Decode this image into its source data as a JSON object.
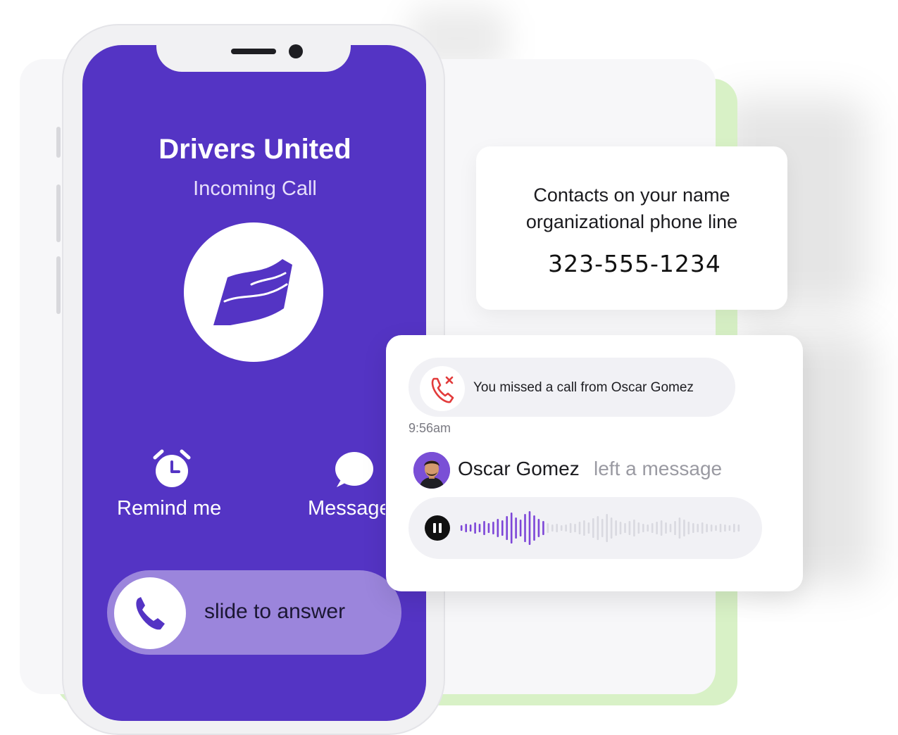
{
  "phone": {
    "caller_name": "Drivers United",
    "call_status": "Incoming Call",
    "actions": {
      "remind_label": "Remind me",
      "message_label": "Message"
    },
    "slide_label": "slide to answer"
  },
  "contact_card": {
    "line1": "Contacts on your name",
    "line2": "organizational phone line",
    "phone_number": "323-555-1234"
  },
  "messages": {
    "missed_call_text": "You missed a call from Oscar Gomez",
    "timestamp": "9:56am",
    "voicemail_sender": "Oscar Gomez",
    "voicemail_text": "left a message",
    "voicemail_progress": 0.3
  },
  "colors": {
    "phone_screen": "#5434c4",
    "slider": "#9b85dc",
    "accent_green": "#d8f1c6",
    "missed_red": "#e23b3b",
    "wave_played": "#7d46d8",
    "wave_unplayed": "#d9d9e0"
  },
  "icons": {
    "logo": "flag-icon",
    "remind": "alarm-clock-icon",
    "message": "chat-bubble-icon",
    "answer": "phone-icon",
    "missed": "missed-call-icon",
    "audio": "pause-icon"
  }
}
